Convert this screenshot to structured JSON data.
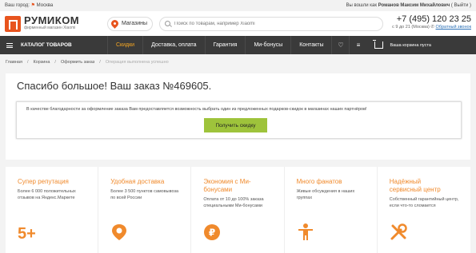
{
  "topbar": {
    "city_label": "Ваш город:",
    "city": "Москва",
    "logged_in_prefix": "Вы вошли как",
    "user": "Романов Максим Михайлович",
    "logout": "( Выйти )"
  },
  "header": {
    "logo_name": "РУМИКОМ",
    "logo_sub": "фирменный магазин Xiaomi",
    "stores_label": "Магазины",
    "search_placeholder": "Поиск по товарам, например Xiaomi",
    "phone": "+7 (495) 120 23 25",
    "phone_hours": "с 9 до 21 (Москва)",
    "callback": "Обратный звонок"
  },
  "nav": {
    "catalog": "КАТАЛОГ ТОВАРОВ",
    "items": [
      "Скидки",
      "Доставка, оплата",
      "Гарантия",
      "Ми-бонусы",
      "Контакты"
    ],
    "cart_text": "Ваша корзина пуста"
  },
  "breadcrumbs": [
    "Главная",
    "Корзина",
    "Оформить заказ",
    "Операция выполнена успешно"
  ],
  "order": {
    "title": "Спасибо большое! Ваш заказ №469605.",
    "gift_text": "В качестве благодарности за оформление заказа Вам предоставляется возможность выбрать один из предложенных подарков-скидок в магазинах наших партнёров!",
    "gift_button": "Получить скидку"
  },
  "features": [
    {
      "title": "Супер репутация",
      "desc": "Более 6 000 положительных отзывов на Яндекс.Маркете",
      "icon": "five-plus-icon"
    },
    {
      "title": "Удобная доставка",
      "desc": "Более 3 500 пунктов самовывоза по всей России",
      "icon": "map-pin-icon"
    },
    {
      "title": "Экономия с Ми-бонусами",
      "desc": "Оплата от 10 до 100% заказа специальными Ми-бонусами",
      "icon": "ruble-coin-icon"
    },
    {
      "title": "Много фанатов",
      "desc": "Живые обсуждения в наших группах",
      "icon": "person-icon"
    },
    {
      "title": "Надёжный сервисный центр",
      "desc": "Собственный гарантийный центр, если что-то сломается",
      "icon": "tools-icon"
    }
  ],
  "colors": {
    "accent": "#e8541e",
    "orange": "#f08a2c",
    "button": "#9ec33b",
    "nav_bg": "#3a3a3a",
    "nav_active": "#f5a623"
  }
}
